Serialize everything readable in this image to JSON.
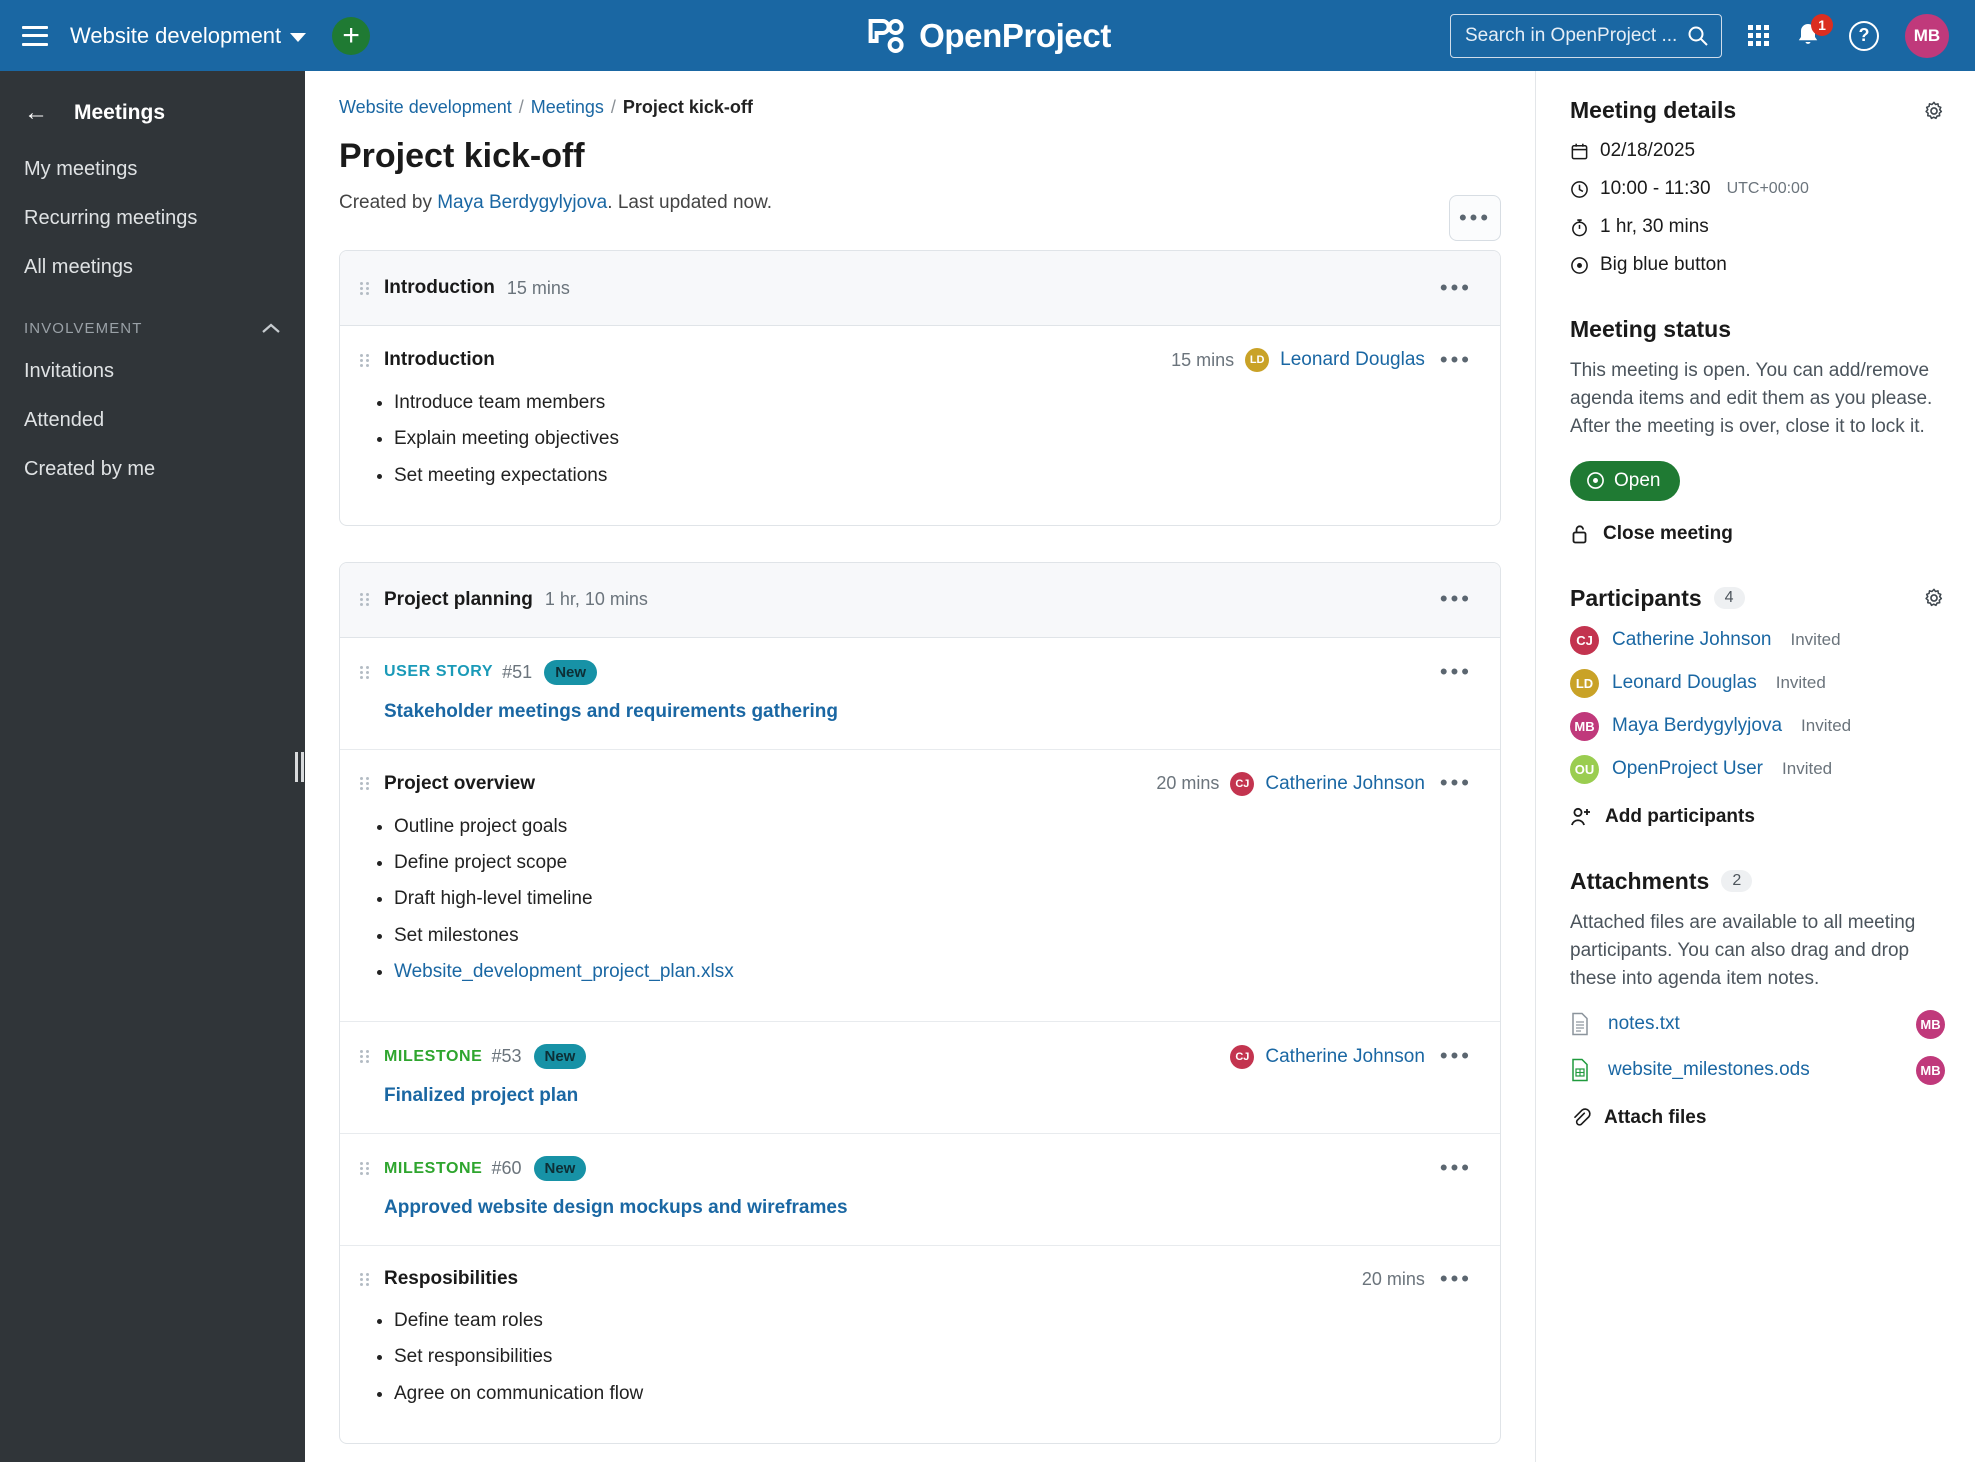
{
  "header": {
    "menu_icon": "hamburger-icon",
    "project_name": "Website development",
    "add_label": "+",
    "logo_text": "OpenProject",
    "search_placeholder": "Search in OpenProject ...",
    "notification_count": "1",
    "help_label": "?",
    "user_initials": "MB"
  },
  "sidebar": {
    "title": "Meetings",
    "items": [
      {
        "label": "My meetings"
      },
      {
        "label": "Recurring meetings"
      },
      {
        "label": "All meetings"
      }
    ],
    "section_label": "INVOLVEMENT",
    "section_items": [
      {
        "label": "Invitations"
      },
      {
        "label": "Attended"
      },
      {
        "label": "Created by me"
      }
    ]
  },
  "breadcrumb": {
    "project": "Website development",
    "module": "Meetings",
    "current": "Project kick-off",
    "sep": "/"
  },
  "page": {
    "title": "Project kick-off",
    "created_prefix": "Created by ",
    "created_by": "Maya Berdygylyjova",
    "created_suffix": ". Last updated now.",
    "more_label": "•••"
  },
  "agenda": [
    {
      "section_title": "Introduction",
      "section_duration": "15 mins",
      "items": [
        {
          "kind": "note",
          "title": "Introduction",
          "duration": "15 mins",
          "presenter": "Leonard Douglas",
          "presenter_initials": "LD",
          "presenter_color": "#C9A227",
          "bullets": [
            {
              "text": "Introduce team members",
              "link": false
            },
            {
              "text": "Explain meeting objectives",
              "link": false
            },
            {
              "text": "Set meeting expectations",
              "link": false
            }
          ]
        }
      ]
    },
    {
      "section_title": "Project planning",
      "section_duration": "1 hr, 10 mins",
      "items": [
        {
          "kind": "work_package",
          "wp_type": "USER STORY",
          "wp_type_class": "userstory",
          "wp_id": "#51",
          "wp_status": "New",
          "subject": "Stakeholder meetings and requirements gathering",
          "duration": "",
          "presenter": "",
          "presenter_initials": "",
          "presenter_color": ""
        },
        {
          "kind": "note",
          "title": "Project overview",
          "duration": "20 mins",
          "presenter": "Catherine Johnson",
          "presenter_initials": "CJ",
          "presenter_color": "#C3344F",
          "bullets": [
            {
              "text": "Outline project goals",
              "link": false
            },
            {
              "text": "Define project scope",
              "link": false
            },
            {
              "text": "Draft high-level timeline",
              "link": false
            },
            {
              "text": "Set milestones",
              "link": false
            },
            {
              "text": "Website_development_project_plan.xlsx",
              "link": true
            }
          ]
        },
        {
          "kind": "work_package",
          "wp_type": "MILESTONE",
          "wp_type_class": "milestone",
          "wp_id": "#53",
          "wp_status": "New",
          "subject": "Finalized project plan",
          "duration": "",
          "presenter": "Catherine Johnson",
          "presenter_initials": "CJ",
          "presenter_color": "#C3344F"
        },
        {
          "kind": "work_package",
          "wp_type": "MILESTONE",
          "wp_type_class": "milestone",
          "wp_id": "#60",
          "wp_status": "New",
          "subject": "Approved website design mockups and wireframes",
          "duration": "",
          "presenter": "",
          "presenter_initials": "",
          "presenter_color": ""
        },
        {
          "kind": "note",
          "title": "Resposibilities",
          "duration": "20 mins",
          "presenter": "",
          "presenter_initials": "",
          "presenter_color": "",
          "bullets": [
            {
              "text": "Define team roles",
              "link": false
            },
            {
              "text": "Set responsibilities",
              "link": false
            },
            {
              "text": "Agree on communication flow",
              "link": false
            }
          ]
        }
      ]
    }
  ],
  "details": {
    "title": "Meeting details",
    "date": "02/18/2025",
    "time": "10:00 - 11:30",
    "timezone": "UTC+00:00",
    "duration": "1 hr, 30 mins",
    "location": "Big blue button"
  },
  "status": {
    "title": "Meeting status",
    "description": "This meeting is open. You can add/remove agenda items and edit them as you please. After the meeting is over, close it to lock it.",
    "open_label": "Open",
    "close_label": "Close meeting"
  },
  "participants": {
    "title": "Participants",
    "count": "4",
    "list": [
      {
        "name": "Catherine Johnson",
        "initials": "CJ",
        "state": "Invited",
        "color": "#C3344F"
      },
      {
        "name": "Leonard Douglas",
        "initials": "LD",
        "state": "Invited",
        "color": "#C9A227"
      },
      {
        "name": "Maya Berdygylyjova",
        "initials": "MB",
        "state": "Invited",
        "color": "#C0397B"
      },
      {
        "name": "OpenProject User",
        "initials": "OU",
        "state": "Invited",
        "color": "#9ACD50"
      }
    ],
    "add_label": "Add participants"
  },
  "attachments": {
    "title": "Attachments",
    "count": "2",
    "description": "Attached files are available to all meeting participants. You can also drag and drop these into agenda item notes.",
    "files": [
      {
        "name": "notes.txt",
        "uploader_initials": "MB",
        "uploader_color": "#C0397B",
        "icon": "text-file-icon"
      },
      {
        "name": "website_milestones.ods",
        "uploader_initials": "MB",
        "uploader_color": "#C0397B",
        "icon": "spreadsheet-file-icon"
      }
    ],
    "attach_label": "Attach files"
  },
  "colors": {
    "header_blue": "#1A67A3",
    "link_blue": "#1A67A3",
    "green": "#1F7A33",
    "teal": "#1792A6",
    "milestone_green": "#2EA52E"
  }
}
